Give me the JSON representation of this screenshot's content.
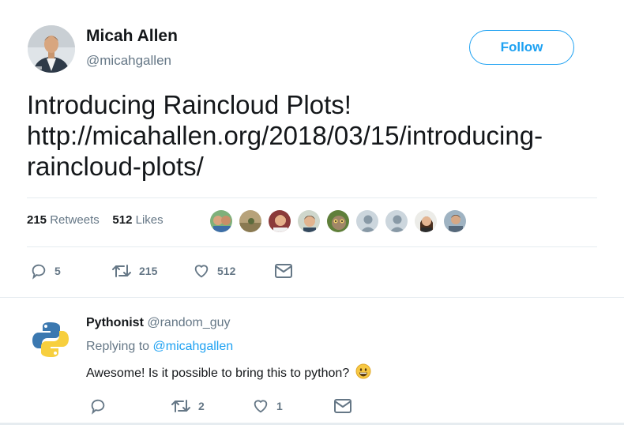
{
  "tweet": {
    "author": {
      "name": "Micah Allen",
      "handle": "@micahgallen"
    },
    "follow_label": "Follow",
    "text_lines": [
      "Introducing Raincloud Plots!",
      "http://micahallen.org/2018/03/15/introducing-",
      "raincloud-plots/"
    ],
    "stats": {
      "retweets_count": "215",
      "retweets_label": "Retweets",
      "likes_count": "512",
      "likes_label": "Likes"
    },
    "actions": {
      "replies": "5",
      "retweets": "215",
      "likes": "512"
    }
  },
  "reply": {
    "author_name": "Pythonist",
    "author_handle": "@random_guy",
    "replying_prefix": "Replying to",
    "replying_to": "@micahgallen",
    "text": "Awesome! Is it possible to bring this to python?",
    "actions": {
      "replies": "",
      "retweets": "2",
      "likes": "1"
    }
  },
  "colors": {
    "accent": "#1da1f2",
    "text": "#14171a",
    "secondary": "#657786",
    "divider": "#e6ecf0"
  },
  "icons": {
    "reply": "speech-bubble-icon",
    "retweet": "retweet-arrows-icon",
    "like": "heart-icon",
    "message": "envelope-icon",
    "emoji": "grinning-face-icon"
  }
}
